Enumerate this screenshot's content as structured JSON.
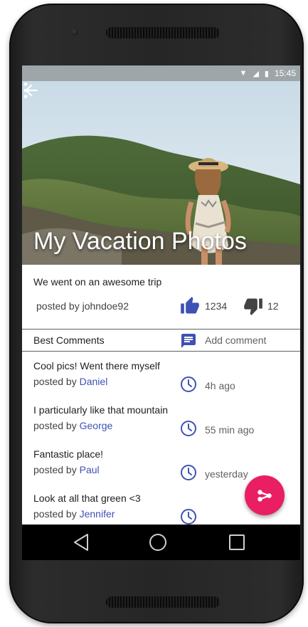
{
  "status_bar": {
    "time": "15:45",
    "icons": [
      "wifi-icon",
      "signal-icon",
      "battery-icon"
    ]
  },
  "header": {
    "title": "My Vacation Photos",
    "back_icon": "arrow-back-icon",
    "menu_icon": "more-vert-icon"
  },
  "post": {
    "description": "We went on an awesome trip",
    "author": "posted by johndoe92",
    "likes": "1234",
    "dislikes": "12"
  },
  "comments_section": {
    "title": "Best Comments",
    "add_label": "Add comment",
    "by_prefix": "posted by ",
    "items": [
      {
        "text": "Cool pics! Went there myself",
        "user": "Daniel",
        "time": "4h ago"
      },
      {
        "text": "I particularly like that mountain",
        "user": "George",
        "time": "55 min ago"
      },
      {
        "text": "Fantastic place!",
        "user": "Paul",
        "time": "yesterday"
      },
      {
        "text": "Look at all that green <3",
        "user": "Jennifer",
        "time": ""
      }
    ]
  },
  "fab": {
    "icon": "share-icon"
  },
  "navigation": {
    "icons": [
      "nav-back-icon",
      "nav-home-icon",
      "nav-recents-icon"
    ]
  },
  "colors": {
    "accent": "#e91e63",
    "primary": "#3f51b5",
    "status_bar": "#9fa6a9"
  }
}
